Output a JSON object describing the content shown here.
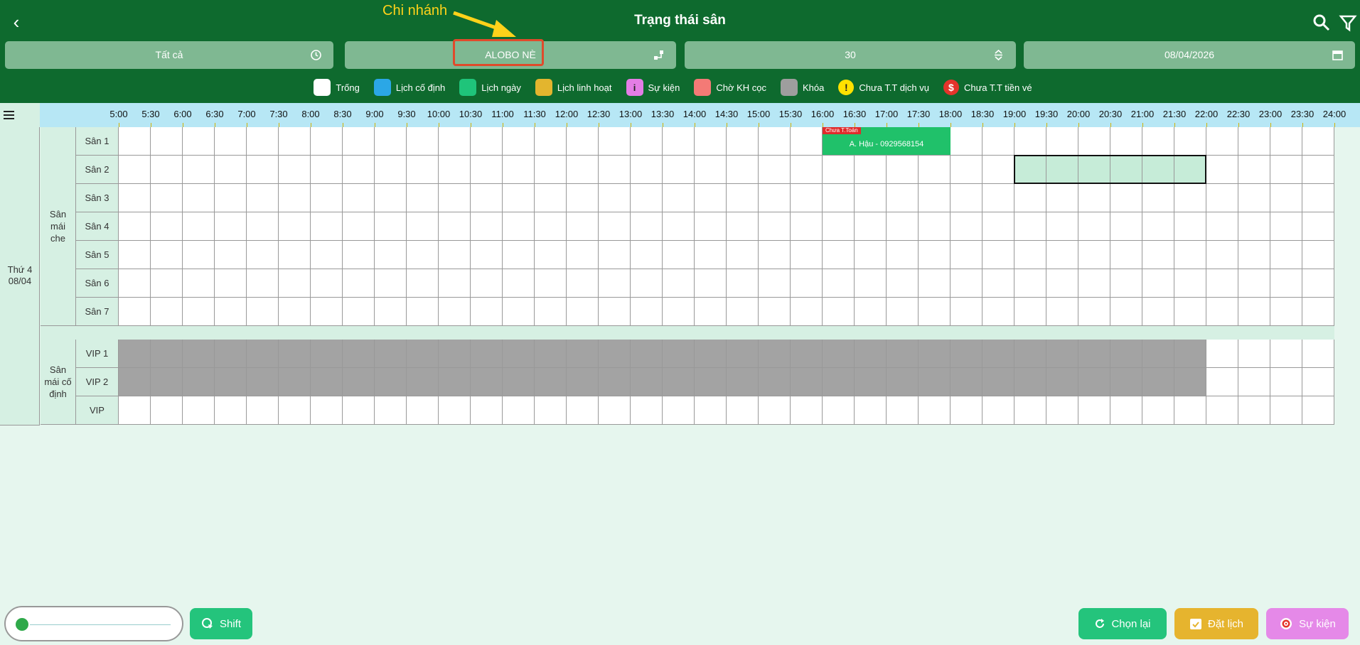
{
  "header": {
    "title": "Trạng thái sân"
  },
  "annotation": {
    "text": "Chi nhánh"
  },
  "filters": [
    {
      "label": "Tất cả",
      "icon": "clock-icon"
    },
    {
      "label": "ALOBO NÈ",
      "icon": "branch-icon"
    },
    {
      "label": "30",
      "icon": "sort-icon"
    },
    {
      "label": "08/04/2026",
      "icon": "calendar-icon"
    }
  ],
  "legend": [
    {
      "label": "Trống",
      "color": "#ffffff"
    },
    {
      "label": "Lịch cố định",
      "color": "#2ba7e6"
    },
    {
      "label": "Lịch ngày",
      "color": "#1fc47a"
    },
    {
      "label": "Lịch linh hoạt",
      "color": "#e3b52e"
    },
    {
      "label": "Sự kiện",
      "color": "#e47de6",
      "glyph": "i"
    },
    {
      "label": "Chờ KH cọc",
      "color": "#f47a76"
    },
    {
      "label": "Khóa",
      "color": "#9e9e9e"
    },
    {
      "label": "Chưa T.T dịch vụ",
      "color": "#ffe100",
      "glyph": "!"
    },
    {
      "label": "Chưa T.T tiền vé",
      "color": "#e4342b",
      "glyph": "$"
    }
  ],
  "times": [
    "5:00",
    "5:30",
    "6:00",
    "6:30",
    "7:00",
    "7:30",
    "8:00",
    "8:30",
    "9:00",
    "9:30",
    "10:00",
    "10:30",
    "11:00",
    "11:30",
    "12:00",
    "12:30",
    "13:00",
    "13:30",
    "14:00",
    "14:30",
    "15:00",
    "15:30",
    "16:00",
    "16:30",
    "17:00",
    "17:30",
    "18:00",
    "18:30",
    "19:00",
    "19:30",
    "20:00",
    "20:30",
    "21:00",
    "21:30",
    "22:00",
    "22:30",
    "23:00",
    "23:30",
    "24:00"
  ],
  "day": {
    "weekday": "Thứ 4",
    "date": "08/04"
  },
  "groups": [
    {
      "name": "Sân mái che",
      "courts": [
        "Sân 1",
        "Sân 2",
        "Sân 3",
        "Sân 4",
        "Sân 5",
        "Sân 6",
        "Sân 7"
      ]
    },
    {
      "name": "Sân mái cố định",
      "courts": [
        "VIP 1",
        "VIP 2",
        "VIP"
      ]
    }
  ],
  "booking": {
    "tag": "Chưa T.Toán",
    "label": "A. Hậu - 0929568154"
  },
  "footer": {
    "shift": "Shift",
    "reset": "Chọn lại",
    "book": "Đặt lịch",
    "event": "Sự kiện"
  }
}
